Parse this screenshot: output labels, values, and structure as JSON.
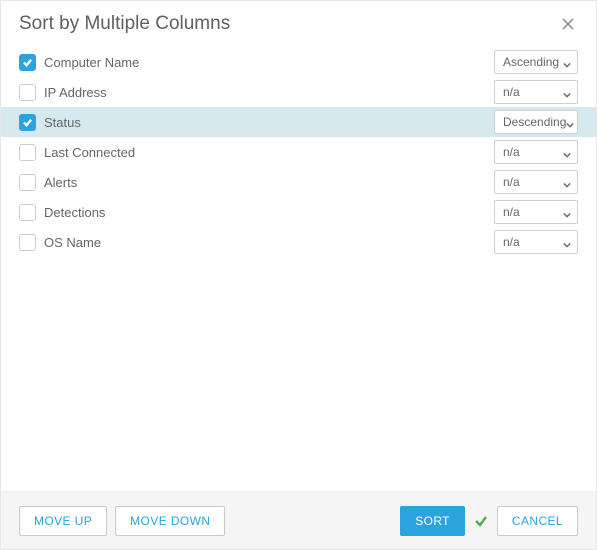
{
  "dialog": {
    "title": "Sort by Multiple Columns"
  },
  "columns": [
    {
      "label": "Computer Name",
      "checked": true,
      "direction": "Ascending",
      "selected": false
    },
    {
      "label": "IP Address",
      "checked": false,
      "direction": "n/a",
      "selected": false
    },
    {
      "label": "Status",
      "checked": true,
      "direction": "Descending",
      "selected": true
    },
    {
      "label": "Last Connected",
      "checked": false,
      "direction": "n/a",
      "selected": false
    },
    {
      "label": "Alerts",
      "checked": false,
      "direction": "n/a",
      "selected": false
    },
    {
      "label": "Detections",
      "checked": false,
      "direction": "n/a",
      "selected": false
    },
    {
      "label": "OS Name",
      "checked": false,
      "direction": "n/a",
      "selected": false
    }
  ],
  "footer": {
    "move_up": "MOVE UP",
    "move_down": "MOVE DOWN",
    "sort": "SORT",
    "cancel": "CANCEL",
    "sort_success": true
  },
  "colors": {
    "accent": "#2aa3df",
    "row_highlight": "#d6e9ef",
    "footer_bg": "#f5f5f5",
    "success": "#4caf50"
  }
}
